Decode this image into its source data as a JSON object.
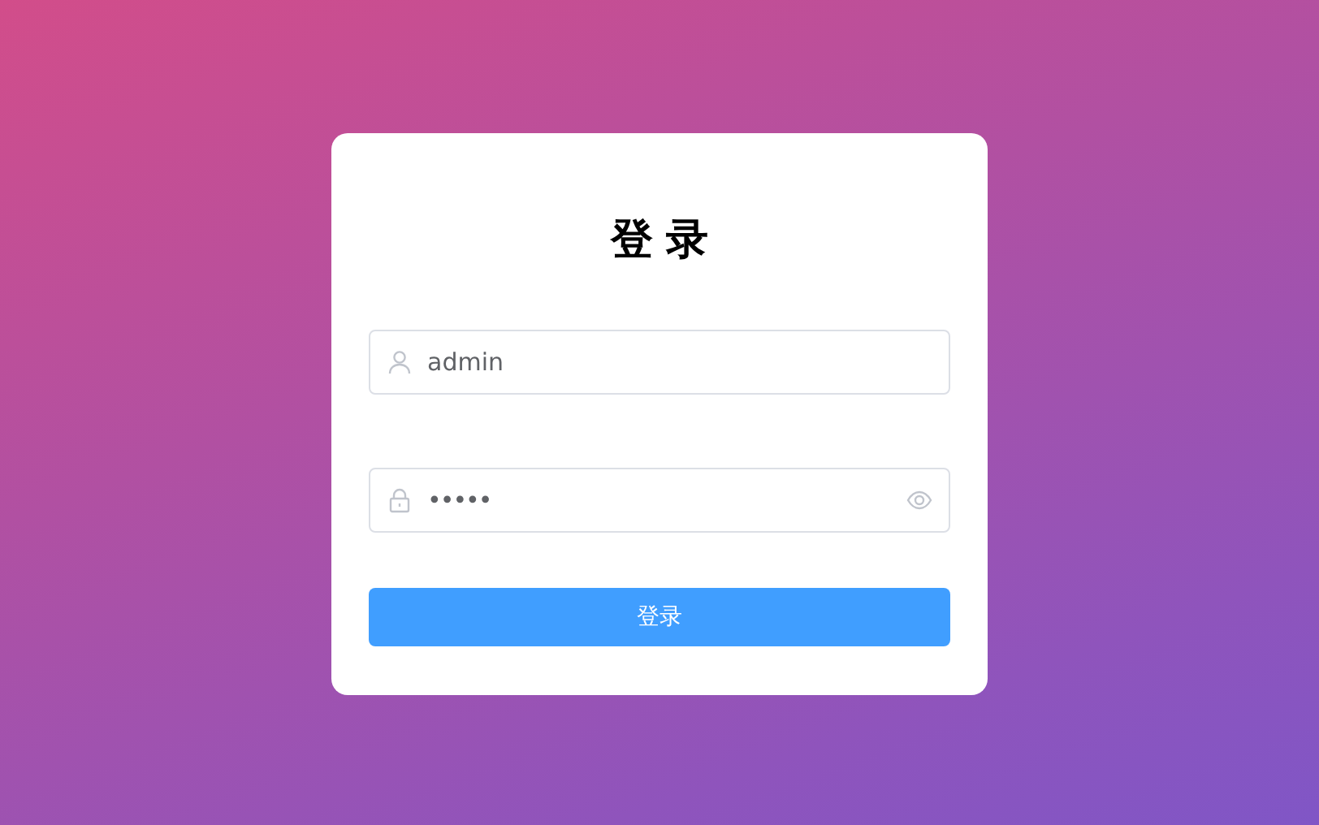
{
  "title": "登录",
  "username": {
    "value": "admin"
  },
  "password": {
    "value": "•••••"
  },
  "submit": {
    "label": "登录"
  }
}
